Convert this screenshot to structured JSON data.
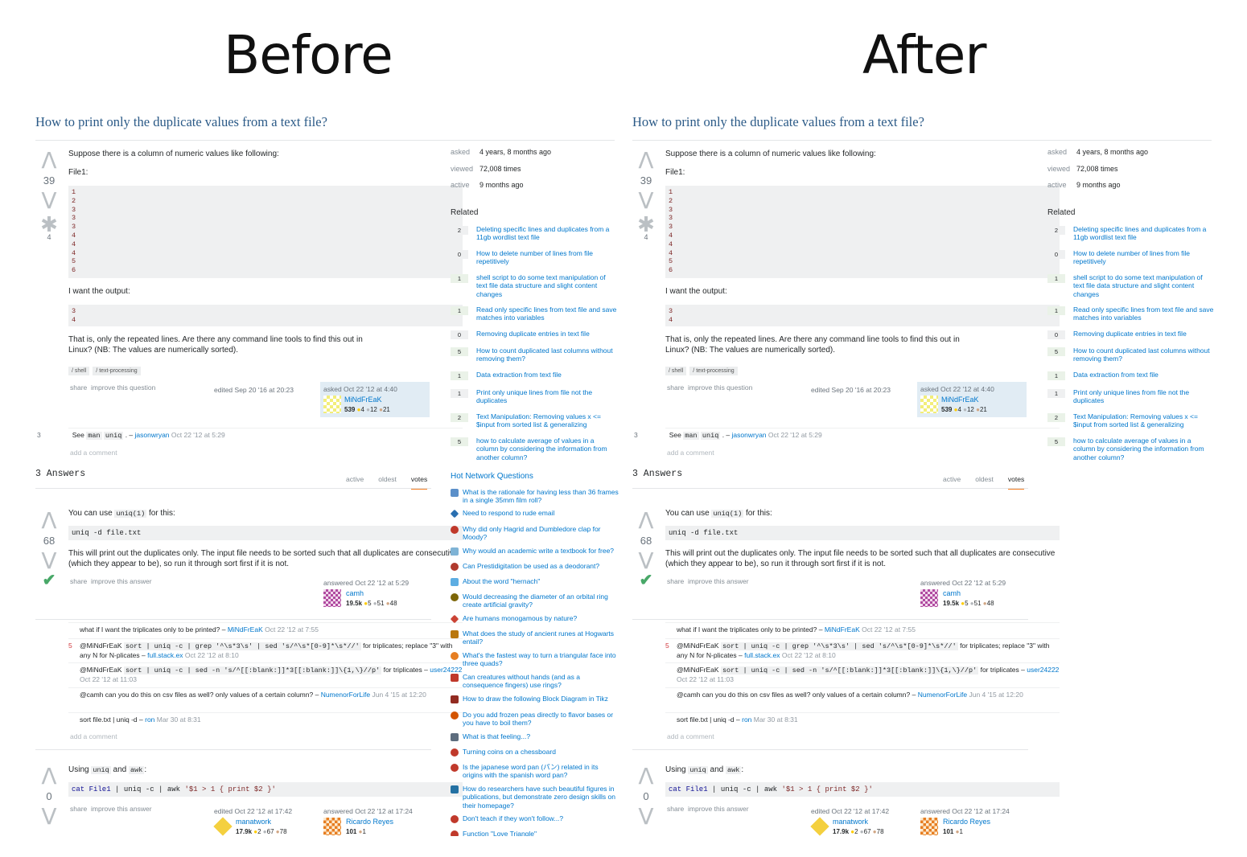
{
  "labels": {
    "before": "Before",
    "after": "After"
  },
  "question": {
    "title": "How to print only the duplicate values from a text file?",
    "votes": "39",
    "favorites": "4",
    "intro": "Suppose there is a column of numeric values like following:",
    "file_label": "File1:",
    "file_lines": [
      "1",
      "2",
      "3",
      "3",
      "3",
      "4",
      "4",
      "4",
      "5",
      "6"
    ],
    "want_output": "I want the output:",
    "output_lines": [
      "3",
      "4"
    ],
    "explanation": "That is, only the repeated lines. Are there any command line tools to find this out in Linux? (NB: The values are numerically sorted).",
    "tags": [
      "shell",
      "text-processing"
    ],
    "share": "share",
    "improve": "improve this question",
    "edited": "edited Sep 20 '16 at 20:23",
    "asked_time": "asked Oct 22 '12 at 4:40",
    "user": "MiNdFrEaK",
    "rep": "539",
    "gold": "4",
    "silver": "12",
    "bronze": "21",
    "comment": {
      "score": "3",
      "pre": "See",
      "code1": "man",
      "code2": "uniq",
      "dot": ". –",
      "user": "jasonwryan",
      "time": "Oct 22 '12 at 5:29"
    },
    "add_comment": "add a comment"
  },
  "answers_header": "3 Answers",
  "tabs": [
    "active",
    "oldest",
    "votes"
  ],
  "answer1": {
    "votes": "68",
    "pre": "You can use",
    "code": "uniq(1)",
    "post": "for this:",
    "cmd": "uniq -d file.txt",
    "body": "This will print out the duplicates only. The input file needs to be sorted such that all duplicates are consecutive (which they appear to be), so run it through sort first if it is not.",
    "share": "share",
    "improve": "improve this answer",
    "answered": "answered Oct 22 '12 at 5:29",
    "user": "camh",
    "rep": "19.5k",
    "gold": "5",
    "silver": "51",
    "bronze": "48",
    "comments": [
      {
        "score": "",
        "text": "what if I want the triplicates only to be printed? –",
        "user": "MiNdFrEaK",
        "time": "Oct 22 '12 at 7:55"
      },
      {
        "score": "5",
        "pre": "@MiNdFrEaK",
        "code": "sort | uniq -c | grep '^\\s*3\\s' | sed 's/^\\s*[0-9]*\\s*//'",
        "post": "for triplicates; replace \"3\" with any N for N-plicates –",
        "user": "full.stack.ex",
        "time": "Oct 22 '12 at 8:10"
      },
      {
        "score": "",
        "pre": "@MiNdFrEaK",
        "code": "sort | uniq -c | sed -n 's/^[[:blank:]]*3[[:blank:]]\\{1,\\}//p'",
        "post": "for triplicates –",
        "user": "user24222",
        "time": "Oct 22 '12 at 11:03"
      },
      {
        "score": "",
        "text": "@camh can you do this on csv files as well? only values of a certain column? –",
        "user": "NumenorForLife",
        "time": "Jun 4 '15 at 12:20"
      },
      {
        "score": "",
        "text": "sort file.txt | uniq -d –",
        "user": "ron",
        "time": "Mar 30 at 8:31"
      }
    ],
    "add_comment": "add a comment"
  },
  "answer2": {
    "votes": "0",
    "pre": "Using",
    "code1": "uniq",
    "mid": "and",
    "code2": "awk",
    "post": ":",
    "cmd_kw": "cat",
    "cmd_file": "File1",
    "cmd_rest": " | uniq -c | awk ",
    "cmd_str": "'$1 > 1 { print $2 }'",
    "share": "share",
    "improve": "improve this answer",
    "edited": "edited Oct 22 '12 at 17:42",
    "editor": "manatwork",
    "editor_rep": "17.9k",
    "editor_gold": "2",
    "editor_silver": "67",
    "editor_bronze": "78",
    "answered": "answered Oct 22 '12 at 17:24",
    "user": "Ricardo Reyes",
    "rep": "101",
    "bronze": "1"
  },
  "stats": [
    {
      "k": "asked",
      "v": "4 years, 8 months ago"
    },
    {
      "k": "viewed",
      "v": "72,008 times"
    },
    {
      "k": "active",
      "v": "9 months ago"
    }
  ],
  "related_header": "Related",
  "related": [
    {
      "n": "2",
      "t": "Deleting specific lines and duplicates from a 11gb wordlist text file"
    },
    {
      "n": "0",
      "t": "How to delete number of lines from file repetitively"
    },
    {
      "n": "1",
      "t": "shell script to do some text manipulation of text file data structure and slight content changes"
    },
    {
      "n": "1",
      "t": "Read only specific lines from text file and save matches into variables"
    },
    {
      "n": "0",
      "t": "Removing duplicate entries in text file"
    },
    {
      "n": "5",
      "t": "How to count duplicated last columns without removing them?"
    },
    {
      "n": "1",
      "t": "Data extraction from text file"
    },
    {
      "n": "1",
      "t": "Print only unique lines from file not the duplicates"
    },
    {
      "n": "2",
      "t": "Text Manipulation: Removing values x <= $input from sorted list & generalizing"
    },
    {
      "n": "5",
      "t": "how to calculate average of values in a column by considering the information from another column?"
    }
  ],
  "hnq_header": "Hot Network Questions",
  "hnq": [
    {
      "t": "What is the rationale for having less than 36 frames in a single 35mm film roll?",
      "c": "#5b8fc9"
    },
    {
      "t": "Need to respond to rude email",
      "c": "#2a6fb0"
    },
    {
      "t": "Why did only Hagrid and Dumbledore clap for Moody?",
      "c": "#c0392b"
    },
    {
      "t": "Why would an academic write a textbook for free?",
      "c": "#7fb3d5"
    },
    {
      "t": "Can Prestidigitation be used as a deodorant?",
      "c": "#b03a2e"
    },
    {
      "t": "About the word \"hernach\"",
      "c": "#5dade2"
    },
    {
      "t": "Would decreasing the diameter of an orbital ring create artificial gravity?",
      "c": "#7d6608"
    },
    {
      "t": "Are humans monogamous by nature?",
      "c": "#cb4335"
    },
    {
      "t": "What does the study of ancient runes at Hogwarts entail?",
      "c": "#b9770e"
    },
    {
      "t": "What's the fastest way to turn a triangular face into three quads?",
      "c": "#e67e22"
    },
    {
      "t": "Can creatures without hands (and as a consequence fingers) use rings?",
      "c": "#c0392b"
    },
    {
      "t": "How to draw the following Block Diagram in Tikz",
      "c": "#922b21"
    },
    {
      "t": "Do you add frozen peas directly to flavor bases or you have to boil them?",
      "c": "#d35400"
    },
    {
      "t": "What is that feeling...?",
      "c": "#5d6d7e"
    },
    {
      "t": "Turning coins on a chessboard",
      "c": "#c0392b"
    },
    {
      "t": "Is the japanese word pan (パン) related in its origins with the spanish word pan?",
      "c": "#c0392b"
    },
    {
      "t": "How do researchers have such beautiful figures in publications, but demonstrate zero design skills on their homepage?",
      "c": "#2471a3"
    },
    {
      "t": "Don't teach if they won't follow...?",
      "c": "#c0392b"
    },
    {
      "t": "Function \"Love Triangle\"",
      "c": "#c0392b"
    }
  ],
  "colors": {
    "link": "#0077cc",
    "title": "#2b5a87",
    "accepted": "#48a868",
    "tab_accent": "#f48024"
  }
}
